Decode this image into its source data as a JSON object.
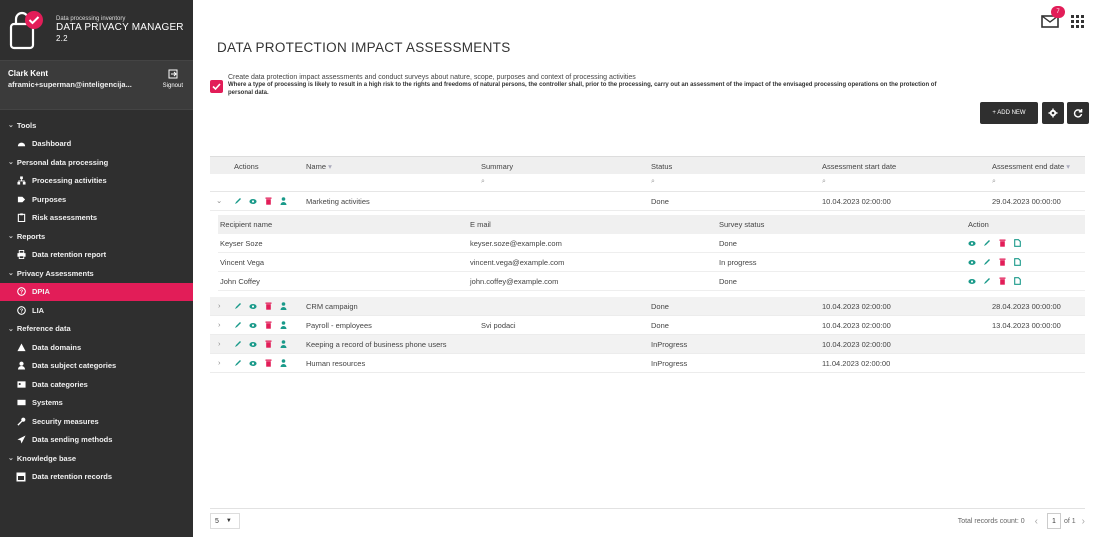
{
  "brand": {
    "subtitle": "Data processing inventory",
    "title": "DATA PRIVACY MANAGER",
    "version": "2.2"
  },
  "user": {
    "name": "Clark Kent",
    "email": "aframic+superman@inteligencija...",
    "signout": "Signout"
  },
  "nav": {
    "tools": "Tools",
    "dashboard": "Dashboard",
    "personal": "Personal data processing",
    "processing": "Processing activities",
    "purposes": "Purposes",
    "risk": "Risk assessments",
    "reports": "Reports",
    "retention_report": "Data retention report",
    "privacy": "Privacy Assessments",
    "dpia": "DPIA",
    "lia": "LIA",
    "reference": "Reference data",
    "domains": "Data domains",
    "subjects": "Data subject categories",
    "categories": "Data categories",
    "systems": "Systems",
    "security": "Security measures",
    "sending": "Data sending methods",
    "knowledge": "Knowledge base",
    "retention_records": "Data retention records"
  },
  "notifications": "7",
  "page": {
    "title": "DATA PROTECTION IMPACT ASSESSMENTS",
    "info1": "Create data protection impact assessments and conduct surveys about nature, scope, purposes and context of processing activities",
    "info2": "Where a type of processing is likely to result in a high risk to the rights and freedoms of natural persons, the controller shall, prior to the processing, carry out an assessment of the impact of the envisaged processing operations on the protection of personal data.",
    "add_new": "+ ADD NEW"
  },
  "table": {
    "headers": {
      "actions": "Actions",
      "name": "Name",
      "summary": "Summary",
      "status": "Status",
      "start": "Assessment start date",
      "end": "Assessment end date"
    },
    "rows": [
      {
        "name": "Marketing activities",
        "summary": "",
        "status": "Done",
        "start": "10.04.2023 02:00:00",
        "end": "29.04.2023 00:00:00"
      },
      {
        "name": "CRM campaign",
        "summary": "",
        "status": "Done",
        "start": "10.04.2023 02:00:00",
        "end": "28.04.2023 00:00:00"
      },
      {
        "name": "Payroll - employees",
        "summary": "Svi podaci",
        "status": "Done",
        "start": "10.04.2023 02:00:00",
        "end": "13.04.2023 00:00:00"
      },
      {
        "name": "Keeping a record of business phone users",
        "summary": "",
        "status": "InProgress",
        "start": "10.04.2023 02:00:00",
        "end": ""
      },
      {
        "name": "Human resources",
        "summary": "",
        "status": "InProgress",
        "start": "11.04.2023 02:00:00",
        "end": ""
      }
    ],
    "sub": {
      "headers": {
        "recipient": "Recipient name",
        "email": "E mail",
        "survey": "Survey status",
        "action": "Action"
      },
      "rows": [
        {
          "name": "Keyser Soze",
          "email": "keyser.soze@example.com",
          "status": "Done"
        },
        {
          "name": "Vincent Vega",
          "email": "vincent.vega@example.com",
          "status": "In progress"
        },
        {
          "name": "John Coffey",
          "email": "john.coffey@example.com",
          "status": "Done"
        }
      ]
    }
  },
  "footer": {
    "page_size": "5",
    "total": "Total records count: 0",
    "page": "1",
    "of": "of 1"
  },
  "colors": {
    "accent": "#e21d58",
    "sidebar": "#2f2f2f",
    "icon_green": "#1a9a8a"
  }
}
